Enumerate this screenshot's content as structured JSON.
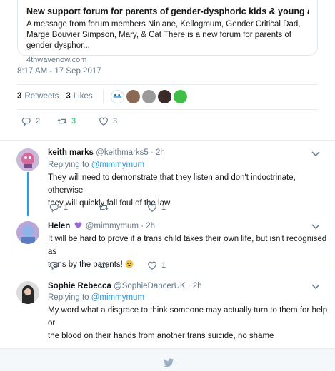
{
  "link_card": {
    "title": "New support forum for parents of gender-dysphoric kids & young adults",
    "description": "A message from forum members Niniane, Kellogmum, Gender Critical Dad, Marge Bouvier Simpson, Mary, & Cat There is a new forum for parents of gender dysphor...",
    "domain": "4thwavenow.com"
  },
  "main_tweet": {
    "timestamp": "8:17 AM - 17 Sep 2017",
    "retweets_count": "3",
    "retweets_label": "Retweets",
    "likes_count": "3",
    "likes_label": "Likes",
    "actions": {
      "reply": "2",
      "retweet": "3",
      "like": "3"
    }
  },
  "replies": [
    {
      "name": "keith marks",
      "handle": "@keithmarks5",
      "time": "· 2h",
      "replying_label": "Replying to",
      "replying_to": "@mimmymum",
      "text_lines": [
        "They will need to demonstrate that they listen and don't indoctrinate, otherwise",
        "they will quickly fall foul of the law."
      ],
      "actions": {
        "reply": "1",
        "retweet": "",
        "like": "1"
      }
    },
    {
      "name": "Helen",
      "name_emoji": "purple-heart",
      "handle": "@mimmymum",
      "time": "· 2h",
      "text_lines": [
        "It will be hard to prove if a trans child takes their own life, but isn't recognised as",
        "trans by the parents!"
      ],
      "text_emoji": "flushed-face",
      "actions": {
        "reply": "",
        "retweet": "",
        "like": "1"
      }
    },
    {
      "name": "Sophie Rebecca",
      "handle": "@SophieDancerUK",
      "time": "· 2h",
      "replying_label": "Replying to",
      "replying_to": "@mimmymum",
      "text_lines": [
        "My word what a disgrace to think someone may actually turn to them for help or",
        "the blood on their hands from another trans suicide, no shame"
      ]
    }
  ],
  "colors": {
    "accent": "#1da1f2",
    "mention": "#1b95e0",
    "muted": "#657786",
    "retweet_count": "#17bf63",
    "heart_emoji": "#9b6bd3",
    "flushed_emoji": "#f5c542"
  }
}
